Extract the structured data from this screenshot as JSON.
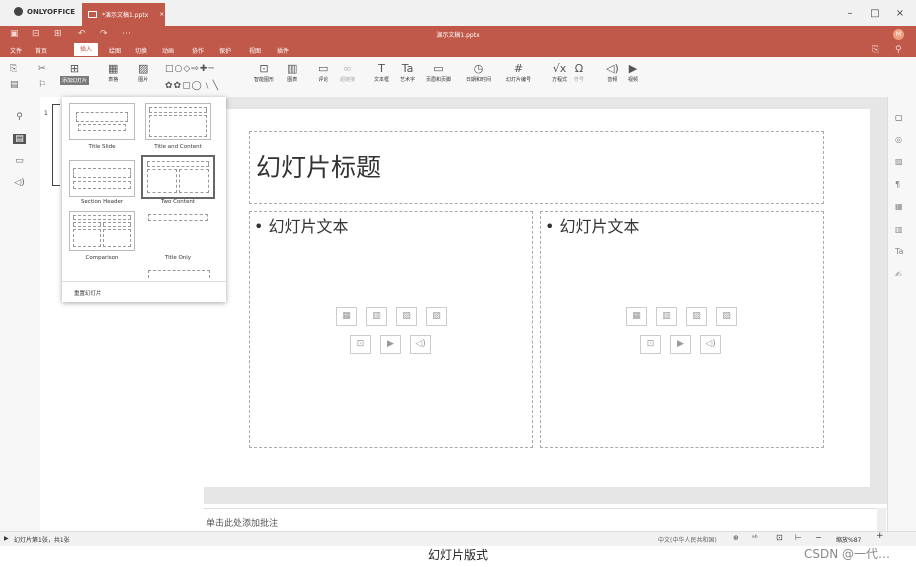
{
  "app": {
    "name": "ONLYOFFICE",
    "tab_title": "*演示文稿1.pptx",
    "close_tab": "×"
  },
  "window": {
    "minimize": "–",
    "maximize": "□",
    "close": "×"
  },
  "header": {
    "doc_title": "演示文稿1.pptx",
    "avatar": "M"
  },
  "menu": [
    "文件",
    "首页",
    "插入",
    "绘图",
    "切换",
    "动画",
    "协作",
    "保护",
    "视图",
    "插件"
  ],
  "active_menu": "插入",
  "toolbar": {
    "new_slide": "添加幻灯片",
    "table": "表格",
    "image": "图片",
    "smartart": "智能图形",
    "chart": "图表",
    "comment": "评论",
    "hyperlink": "超链接",
    "textbox": "文本框",
    "textart": "艺术字",
    "header_footer": "页眉和页脚",
    "datetime": "日期和时间",
    "slide_number": "幻灯片编号",
    "equation": "方程式",
    "symbol": "符号",
    "audio": "音频",
    "video": "视频"
  },
  "slide": {
    "number": "1",
    "title": "幻灯片标题",
    "left_body": "• 幻灯片文本",
    "right_body": "• 幻灯片文本"
  },
  "notes_placeholder": "单击此处添加批注",
  "layouts": {
    "items": [
      "Title Slide",
      "Title and Content",
      "Section Header",
      "Two Content",
      "Comparison",
      "Title Only"
    ],
    "selected": "Two Content",
    "reset": "重置幻灯片"
  },
  "status": {
    "slide_label": "幻灯片第1张，共1张",
    "language": "中文(中华人民共和国)",
    "zoom": "缩放%87",
    "zoom_plus": "+"
  },
  "caption": "幻灯片版式",
  "watermark": "CSDN @一代…",
  "colors": {
    "brand": "#c0594a"
  }
}
